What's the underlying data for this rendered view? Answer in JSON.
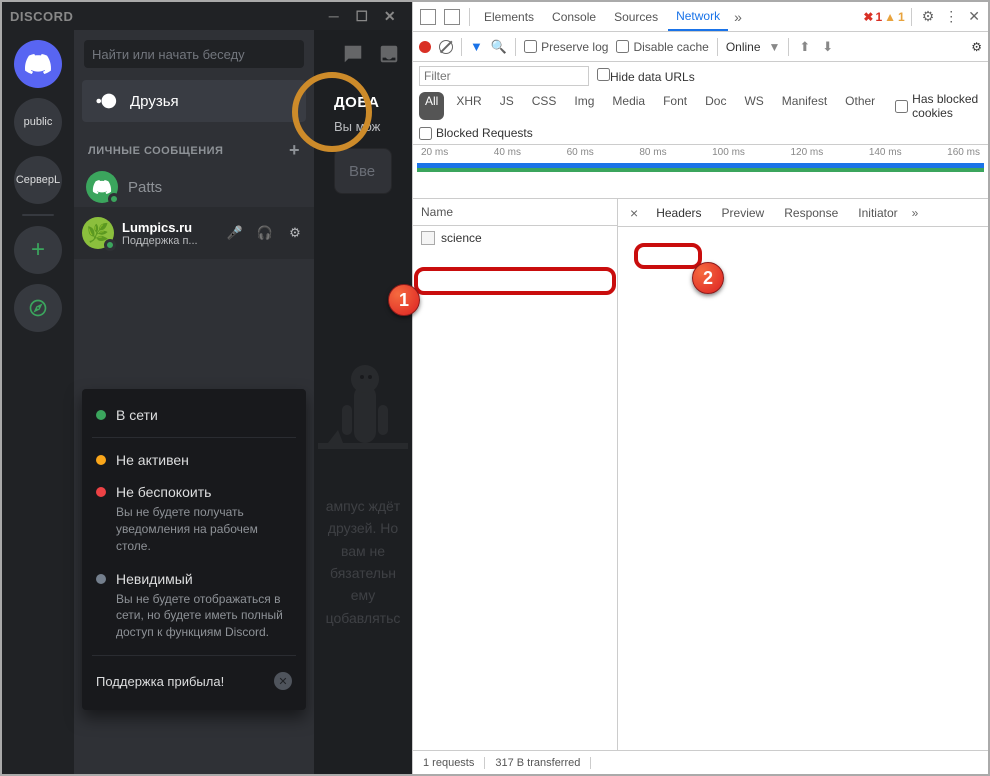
{
  "discord": {
    "title": "DISCORD",
    "search_placeholder": "Найти или начать беседу",
    "friends_label": "Друзья",
    "guilds": {
      "public": "public",
      "server": "СерверL"
    },
    "dm_header": "ЛИЧНЫЕ СООБЩЕНИЯ",
    "dm_item": "Patts",
    "status": {
      "online": "В сети",
      "idle": "Не активен",
      "dnd": "Не беспокоить",
      "dnd_desc": "Вы не будете получать уведомления на рабочем столе.",
      "invisible": "Невидимый",
      "invisible_desc": "Вы не будете отображаться в сети, но будете иметь полный доступ к функциям Discord.",
      "support": "Поддержка прибыла!"
    },
    "user": {
      "name": "Lumpics.ru",
      "sub": "Поддержка п..."
    },
    "add_friend": {
      "title": "ДОБА",
      "sub": "Вы мож",
      "placeholder": "Вве"
    },
    "wumpus_text": "ампус ждёт друзей. Но вам не бязательн ему цобавлятьс"
  },
  "devtools": {
    "tabs": {
      "elements": "Elements",
      "console": "Console",
      "sources": "Sources",
      "network": "Network"
    },
    "errors": "1",
    "warnings": "1",
    "toolbar": {
      "preserve": "Preserve log",
      "disable": "Disable cache",
      "throttle": "Online"
    },
    "filter": {
      "placeholder": "Filter",
      "hide": "Hide data URLs",
      "blocked_cookies": "Has blocked cookies",
      "blocked_req": "Blocked Requests"
    },
    "types": {
      "all": "All",
      "xhr": "XHR",
      "js": "JS",
      "css": "CSS",
      "img": "Img",
      "media": "Media",
      "font": "Font",
      "doc": "Doc",
      "ws": "WS",
      "manifest": "Manifest",
      "other": "Other"
    },
    "timeline": [
      "20 ms",
      "40 ms",
      "60 ms",
      "80 ms",
      "100 ms",
      "120 ms",
      "140 ms",
      "160 ms"
    ],
    "name_header": "Name",
    "request_name": "science",
    "detail_tabs": {
      "headers": "Headers",
      "preview": "Preview",
      "response": "Response",
      "initiator": "Initiator"
    },
    "footer": {
      "requests": "1 requests",
      "transferred": "317 B transferred"
    }
  },
  "callouts": {
    "one": "1",
    "two": "2"
  }
}
